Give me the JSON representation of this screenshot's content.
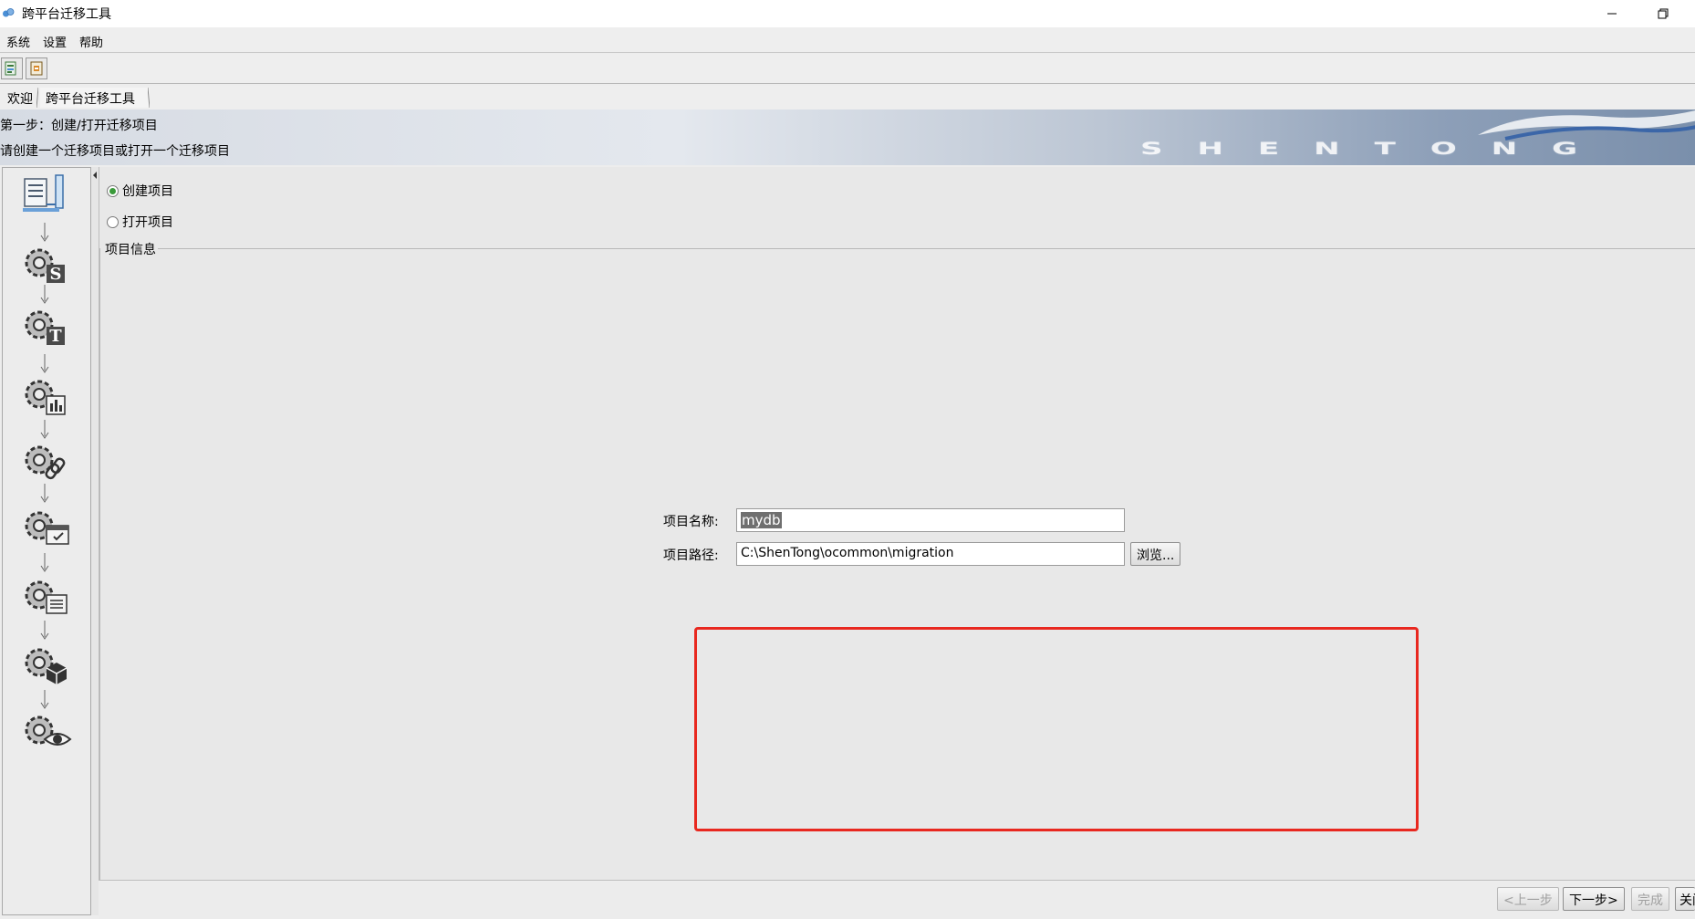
{
  "window": {
    "title": "跨平台迁移工具"
  },
  "menu": [
    "系统",
    "设置",
    "帮助"
  ],
  "tabs": [
    "欢迎",
    "跨平台迁移工具"
  ],
  "banner": {
    "step_title": "第一步：创建/打开迁移项目",
    "step_desc": "请创建一个迁移项目或打开一个迁移项目",
    "logo": "SHENTONG"
  },
  "steps": {
    "icons": [
      "project-icon",
      "gear-s-icon",
      "gear-t-icon",
      "gear-chart-icon",
      "gear-link-icon",
      "gear-calendar-icon",
      "gear-list-icon",
      "gear-box-icon",
      "gear-eye-icon"
    ]
  },
  "options": {
    "create_label": "创建项目",
    "open_label": "打开项目",
    "selected": "create"
  },
  "project_info": {
    "group_title": "项目信息",
    "name_label": "项目名称:",
    "name_value": "mydb",
    "path_label": "项目路径:",
    "path_value": "C:\\ShenTong\\ocommon\\migration",
    "browse_label": "浏览..."
  },
  "nav": {
    "prev_label": "<上一步",
    "next_label": "下一步>",
    "finish_label": "完成",
    "close_label": "关闭"
  },
  "colors": {
    "highlight": "#e8281f",
    "radio_selected": "#3a9a3a"
  }
}
